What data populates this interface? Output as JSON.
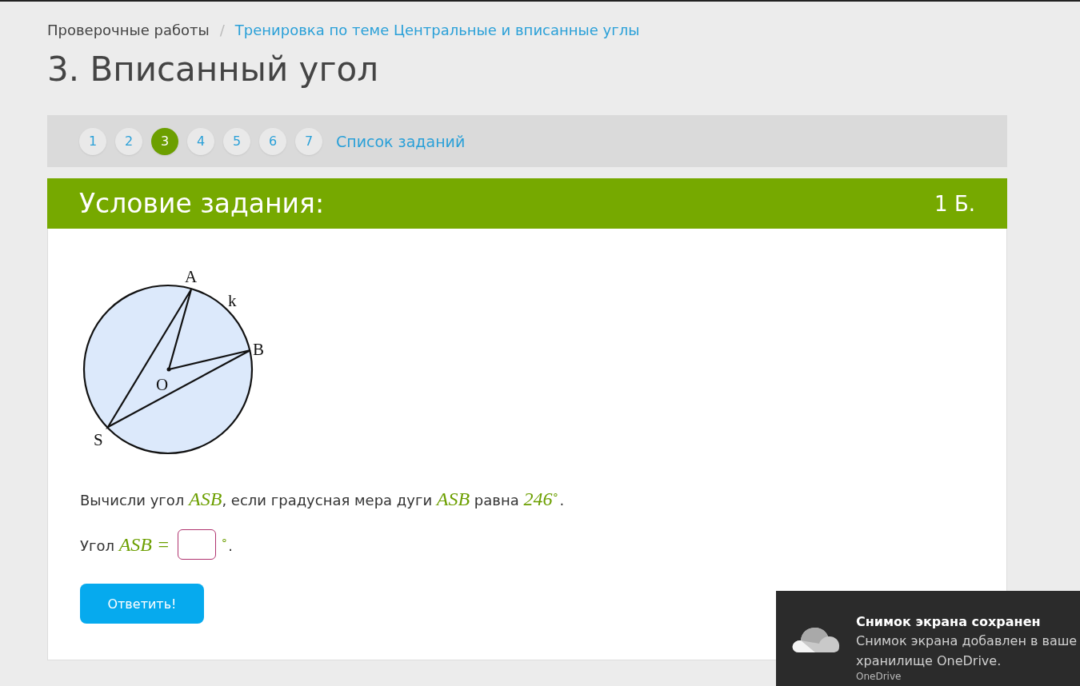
{
  "breadcrumbs": [
    {
      "label": "Проверочные работы",
      "kind": "plain"
    },
    {
      "label": "/",
      "kind": "separator"
    },
    {
      "label": "Тренировка по теме Центральные и вписанные углы",
      "kind": "link"
    }
  ],
  "title": "3. Вписанный угол",
  "pager": {
    "pages": [
      {
        "label": "1",
        "selected": false
      },
      {
        "label": "2",
        "selected": false
      },
      {
        "label": "3",
        "selected": true
      },
      {
        "label": "4",
        "selected": false
      },
      {
        "label": "5",
        "selected": false
      },
      {
        "label": "6",
        "selected": false
      },
      {
        "label": "7",
        "selected": false
      }
    ],
    "list_link": "Список заданий"
  },
  "task": {
    "heading": "Условие задания:",
    "points": "1 Б.",
    "figure": {
      "labels": [
        "A",
        "k",
        "B",
        "O",
        "S"
      ]
    },
    "question": [
      {
        "kind": "text",
        "text": "Вычисли угол "
      },
      {
        "kind": "math",
        "text": "ASB"
      },
      {
        "kind": "text",
        "text": ", если градусная мера дуги "
      },
      {
        "kind": "math",
        "text": "ASB"
      },
      {
        "kind": "text",
        "text": " равна "
      },
      {
        "kind": "math",
        "text": "246$^{∘}$"
      },
      {
        "kind": "text",
        "text": "."
      }
    ],
    "answer": {
      "before": [
        {
          "kind": "text",
          "text": "Угол "
        },
        {
          "kind": "math",
          "text": "ASB ="
        }
      ],
      "after": [
        {
          "kind": "math",
          "text": "$^{∘}$"
        },
        {
          "kind": "text",
          "text": "."
        }
      ]
    },
    "submit": "Ответить!"
  },
  "toast": {
    "title": "Снимок экрана сохранен",
    "body_lines": [
      "Снимок экрана добавлен в ваше",
      "хранилище OneDrive."
    ],
    "source": "OneDrive"
  }
}
